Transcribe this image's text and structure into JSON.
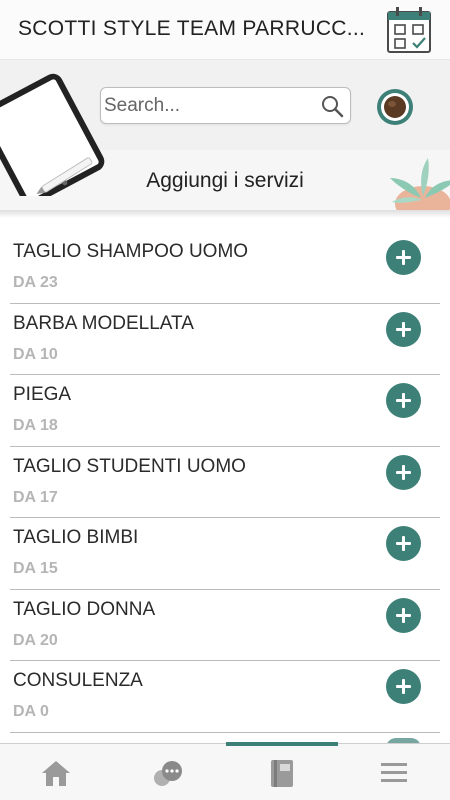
{
  "header": {
    "title": "SCOTTI STYLE TEAM PARRUCC...",
    "calendar_icon": "calendar-check-icon"
  },
  "search": {
    "placeholder": "Search...",
    "icon": "search-icon"
  },
  "section": {
    "title": "Aggiungi i servizi"
  },
  "services": [
    {
      "name": "TAGLIO SHAMPOO UOMO",
      "price": "DA 23"
    },
    {
      "name": "BARBA MODELLATA",
      "price": "DA 10"
    },
    {
      "name": "PIEGA",
      "price": "DA 18"
    },
    {
      "name": "TAGLIO STUDENTI UOMO",
      "price": "DA 17"
    },
    {
      "name": "TAGLIO BIMBI",
      "price": "DA 15"
    },
    {
      "name": "TAGLIO DONNA",
      "price": "DA 20"
    },
    {
      "name": "CONSULENZA",
      "price": "DA 0"
    }
  ],
  "tabbar": {
    "tabs": [
      {
        "icon": "home-icon"
      },
      {
        "icon": "chat-icon"
      },
      {
        "icon": "book-icon",
        "active": true
      },
      {
        "icon": "menu-icon"
      }
    ]
  },
  "colors": {
    "accent": "#3d8077",
    "price_text": "#b5b5b5",
    "header_bg": "#fbfbfb"
  }
}
